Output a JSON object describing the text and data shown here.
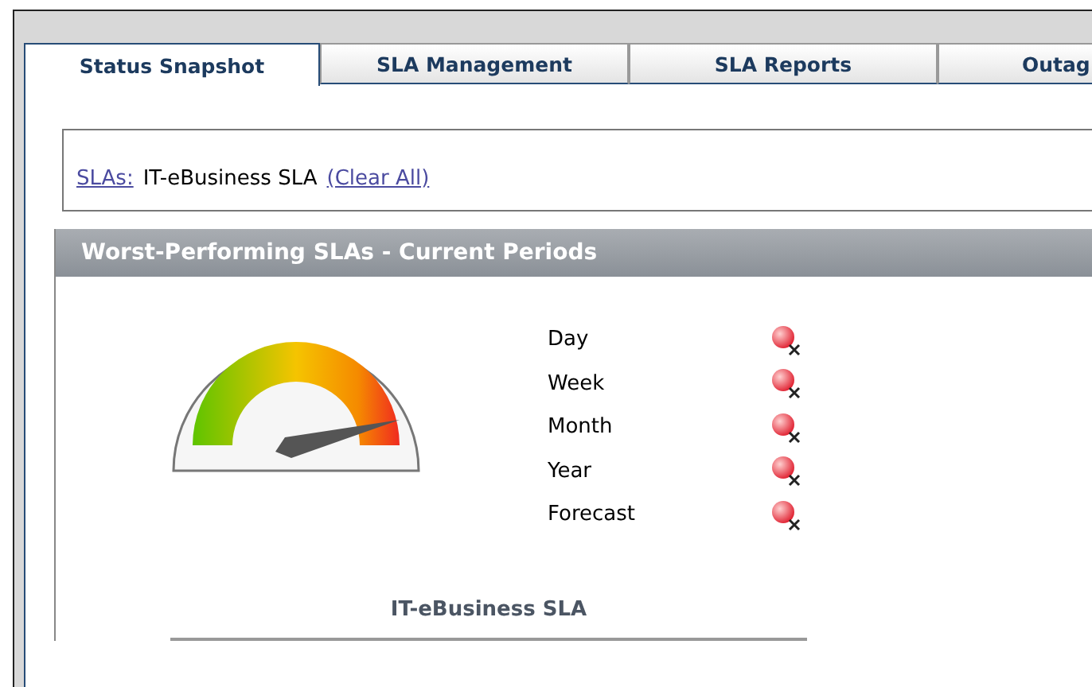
{
  "tabs": [
    {
      "label": "Status Snapshot",
      "selected": true
    },
    {
      "label": "SLA Management",
      "selected": false
    },
    {
      "label": "SLA Reports",
      "selected": false
    },
    {
      "label": "Outag",
      "selected": false
    }
  ],
  "filter": {
    "link": "SLAs:",
    "value": "IT-eBusiness SLA",
    "clear": "(Clear All)"
  },
  "panel": {
    "title": "Worst-Performing SLAs - Current Periods",
    "periods": [
      {
        "label": "Day"
      },
      {
        "label": "Week"
      },
      {
        "label": "Month"
      },
      {
        "label": "Year"
      },
      {
        "label": "Forecast"
      }
    ],
    "sla_name": "IT-eBusiness SLA"
  }
}
